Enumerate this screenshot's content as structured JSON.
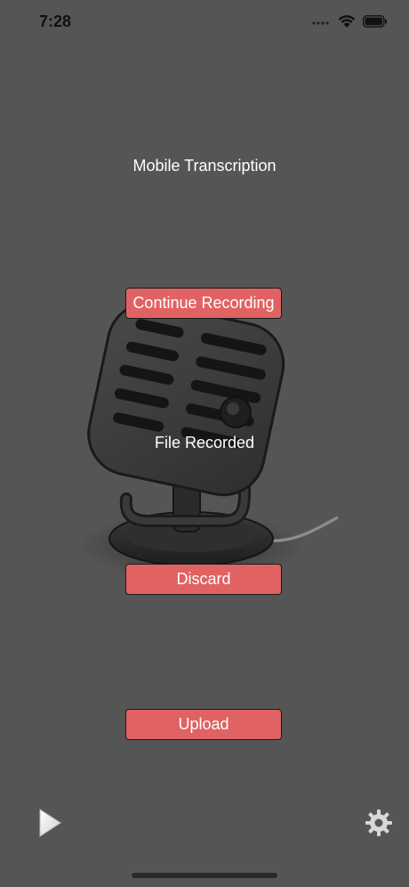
{
  "status_bar": {
    "time": "7:28",
    "icons": [
      "signal-icon",
      "wifi-icon",
      "battery-icon"
    ]
  },
  "app": {
    "title": "Mobile Transcription",
    "status": "File Recorded"
  },
  "buttons": {
    "continue_label": "Continue Recording",
    "discard_label": "Discard",
    "upload_label": "Upload"
  },
  "footer": {
    "play_icon": "play-icon",
    "settings_icon": "gear-icon"
  },
  "colors": {
    "background": "#555555",
    "button": "#e16262",
    "text": "#ffffff"
  }
}
